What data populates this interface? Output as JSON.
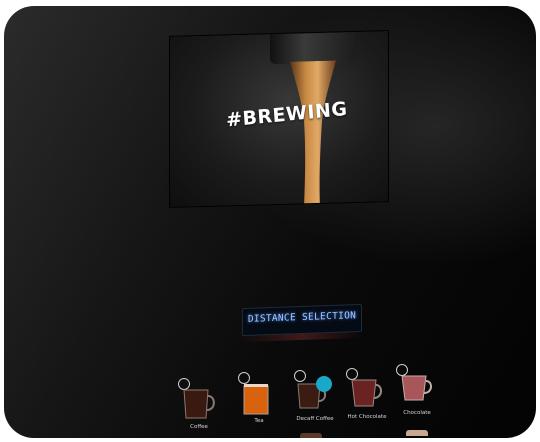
{
  "display": {
    "brewing_text": "#BREWING"
  },
  "selector": {
    "lcd_text": "DISTANCE SELECTION"
  },
  "drinks": [
    {
      "label": "Coffee",
      "icon": "coffee-mug-icon",
      "liquid": "#3a1a10"
    },
    {
      "label": "Tea",
      "icon": "tea-glass-icon",
      "liquid": "#d9620f"
    },
    {
      "label": "Decaff Coffee",
      "icon": "decaf-coffee-icon",
      "liquid": "#3b1c12",
      "badge_color": "#1aa8c8"
    },
    {
      "label": "Hot Chocolate",
      "icon": "hot-chocolate-icon",
      "liquid": "#6a2222"
    },
    {
      "label": "Chocolate",
      "icon": "chocolate-icon",
      "liquid": "#a8565a"
    }
  ],
  "colors": {
    "panel": "#0a0a0a",
    "coffee_stream": "#c98a45",
    "lcd_text": "#9fc6ff"
  }
}
